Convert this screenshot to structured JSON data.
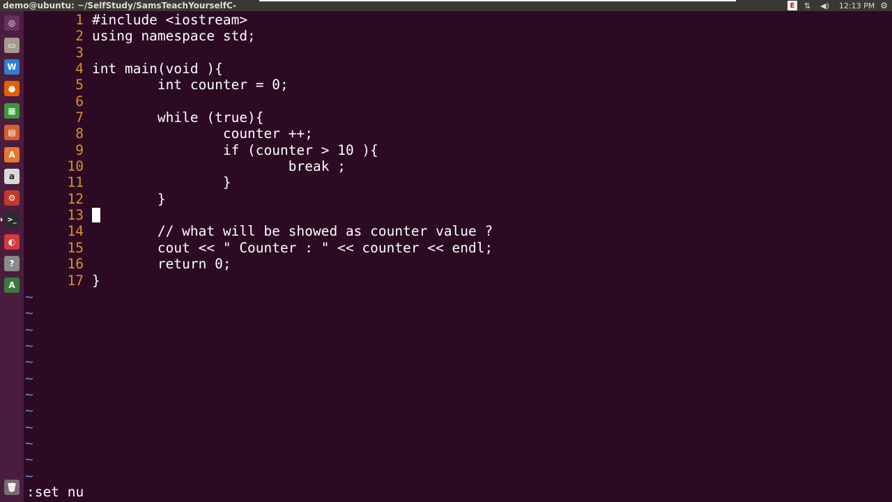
{
  "window": {
    "title": "demo@ubuntu: ~/SelfStudy/SamsTeachYourselfC-",
    "clock": "12:13 PM"
  },
  "tray": [
    {
      "icon": "keyboard-icon",
      "glyph": "E"
    },
    {
      "icon": "network-icon",
      "glyph": "⇅"
    },
    {
      "icon": "volume-icon",
      "glyph": "◀)"
    },
    {
      "icon": "settings-gear-icon",
      "glyph": "⚙"
    }
  ],
  "launcher": [
    {
      "name": "ubuntu-dash-icon",
      "glyph": "◎",
      "color": "#6a2f5e"
    },
    {
      "name": "files-icon",
      "glyph": "▭",
      "color": "#a39a8c"
    },
    {
      "name": "libreoffice-writer-icon",
      "glyph": "W",
      "color": "#2f7fd0"
    },
    {
      "name": "firefox-icon",
      "glyph": "●",
      "color": "#e66000"
    },
    {
      "name": "libreoffice-calc-icon",
      "glyph": "▦",
      "color": "#3a9a3a"
    },
    {
      "name": "libreoffice-impress-icon",
      "glyph": "▤",
      "color": "#d2612a"
    },
    {
      "name": "software-center-icon",
      "glyph": "A",
      "color": "#e8772e"
    },
    {
      "name": "amazon-icon",
      "glyph": "a",
      "color": "#d9d9d9"
    },
    {
      "name": "system-settings-icon",
      "glyph": "⚙",
      "color": "#c0392b"
    },
    {
      "name": "terminal-icon",
      "glyph": ">_",
      "color": "#2b2b2b"
    },
    {
      "name": "pdf-viewer-icon",
      "glyph": "◐",
      "color": "#d33b3b"
    },
    {
      "name": "help-icon",
      "glyph": "?",
      "color": "#8a8a8a"
    },
    {
      "name": "software-updater-icon",
      "glyph": "A",
      "color": "#3a7a3a"
    },
    {
      "name": "trash-icon",
      "glyph": "🗑",
      "color": "#7a6a72"
    }
  ],
  "editor": {
    "lines": [
      {
        "num": "1",
        "text": "#include <iostream>"
      },
      {
        "num": "2",
        "text": "using namespace std;"
      },
      {
        "num": "3",
        "text": ""
      },
      {
        "num": "4",
        "text": "int main(void ){"
      },
      {
        "num": "5",
        "text": "        int counter = 0;"
      },
      {
        "num": "6",
        "text": ""
      },
      {
        "num": "7",
        "text": "        while (true){"
      },
      {
        "num": "8",
        "text": "                counter ++;"
      },
      {
        "num": "9",
        "text": "                if (counter > 10 ){"
      },
      {
        "num": "10",
        "text": "                        break ;"
      },
      {
        "num": "11",
        "text": "                }"
      },
      {
        "num": "12",
        "text": "        }"
      },
      {
        "num": "13",
        "text": ""
      },
      {
        "num": "14",
        "text": "        // what will be showed as counter value ?"
      },
      {
        "num": "15",
        "text": "        cout << \" Counter : \" << counter << endl;"
      },
      {
        "num": "16",
        "text": "        return 0;"
      },
      {
        "num": "17",
        "text": "}"
      }
    ],
    "cursor_line": 13,
    "tilde": "~",
    "tilde_count": 12,
    "command": ":set nu"
  }
}
